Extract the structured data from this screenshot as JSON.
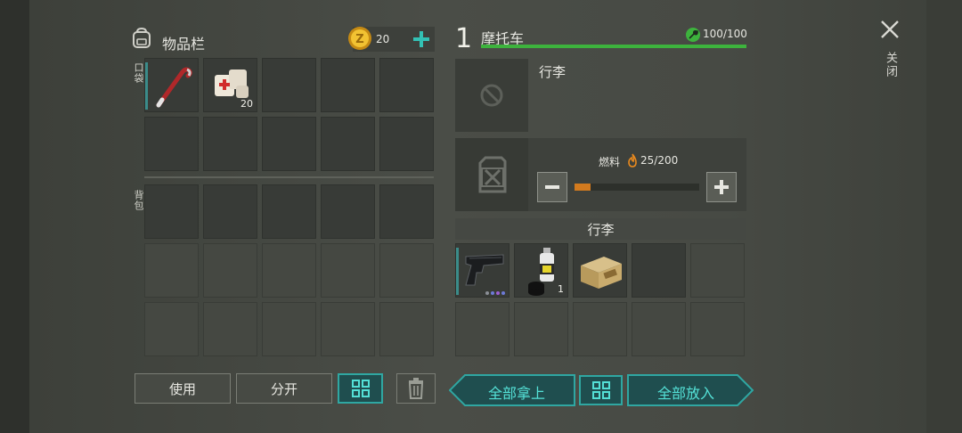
{
  "inventory": {
    "title": "物品栏",
    "coins": "20",
    "pocket_label": "口袋",
    "backpack_label": "背包",
    "pocket_items": [
      {
        "name": "crowbar",
        "count": ""
      },
      {
        "name": "bandage",
        "count": "20"
      }
    ],
    "use_label": "使用",
    "split_label": "分开"
  },
  "vehicle": {
    "level": "1",
    "name": "摩托车",
    "durability": "100/100",
    "durability_fraction": 1.0,
    "luggage_title": "行李",
    "fuel_label": "燃料",
    "fuel_value": "25/200",
    "fuel_fraction": 0.125,
    "storage_header": "行李",
    "storage_items": [
      {
        "name": "pistol",
        "count": ""
      },
      {
        "name": "spray-can",
        "count": "1"
      },
      {
        "name": "ammo-box",
        "count": ""
      }
    ],
    "take_all_label": "全部拿上",
    "put_all_label": "全部放入"
  },
  "close_label": "关闭",
  "colors": {
    "accent_teal": "#2fa7a2",
    "durability_green": "#3db33d",
    "fuel_orange": "#d27a1e"
  }
}
